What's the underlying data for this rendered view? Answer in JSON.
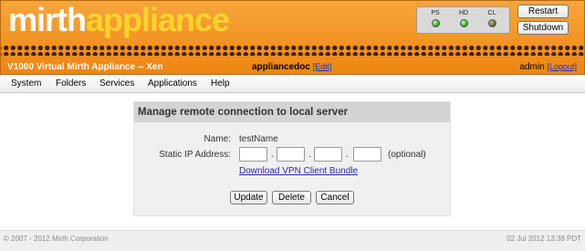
{
  "header": {
    "logo_part1": "mirth",
    "logo_part2": "appliance",
    "leds": [
      {
        "label": "PS",
        "state": "on",
        "color": "#36b21f"
      },
      {
        "label": "HD",
        "state": "on",
        "color": "#36b21f"
      },
      {
        "label": "CL",
        "state": "off",
        "color": "#6d6a3a"
      }
    ],
    "restart_label": "Restart",
    "shutdown_label": "Shutdown",
    "appliance_name": "V1000 Virtual Mirth Appliance -- Xen",
    "hostname": "appliancedoc",
    "edit_link": "[Edit]",
    "username": "admin",
    "logout_link": "[Logout]",
    "brand_orange": "#f39425",
    "brand_yellow": "#ffd42a"
  },
  "menu": {
    "items": [
      "System",
      "Folders",
      "Services",
      "Applications",
      "Help"
    ]
  },
  "panel": {
    "title": "Manage remote connection to local server",
    "name_label": "Name:",
    "name_value": "testName",
    "ip_label": "Static IP Address:",
    "ip_octets": [
      "",
      "",
      "",
      ""
    ],
    "ip_separator": ".",
    "optional_text": "(optional)",
    "vpn_link": "Download VPN Client Bundle",
    "buttons": {
      "update": "Update",
      "delete": "Delete",
      "cancel": "Cancel"
    }
  },
  "footer": {
    "copyright": "© 2007 - 2012 Mirth Corporation",
    "timestamp": "02 Jul 2012 13:38 PDT"
  }
}
